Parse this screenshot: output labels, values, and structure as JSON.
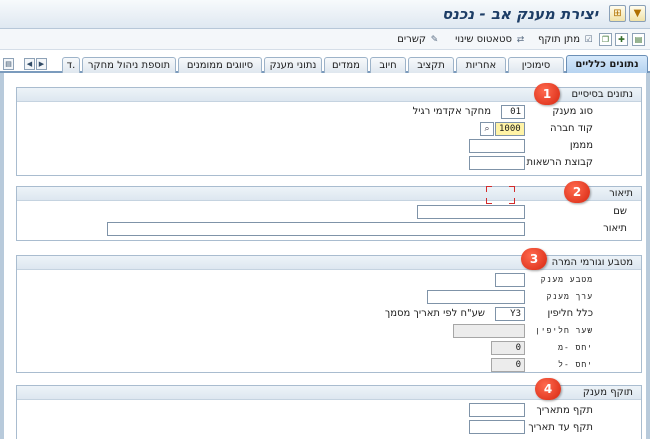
{
  "window": {
    "title": "יצירת מענק אב - נכנס"
  },
  "appbar": {
    "items": [
      {
        "label": "מתן תוקף",
        "icon": "check-list-icon"
      },
      {
        "label": "סטאטוס שינוי",
        "icon": "status-change-icon"
      },
      {
        "label": "קשרים",
        "icon": "relationships-icon"
      }
    ]
  },
  "tabs": [
    {
      "label": "נתונים כלליים",
      "active": true
    },
    {
      "label": "סימוכין"
    },
    {
      "label": "אחריות"
    },
    {
      "label": "תקציב"
    },
    {
      "label": "חיוב"
    },
    {
      "label": "ממדים"
    },
    {
      "label": "נתוני מענק"
    },
    {
      "label": "סיווגים ממומנים"
    },
    {
      "label": "תוספת ניהול מחקר"
    },
    {
      "label": "ד."
    }
  ],
  "groups": {
    "basic": {
      "badge": "1",
      "title": "נתונים בסיסיים",
      "grant_type_label": "סוג מענק",
      "grant_type_value": "01",
      "grant_type_text": "מחקר אקדמי רגיל",
      "company_code_label": "קוד חברה",
      "company_code_value": "1000",
      "sponsor_label": "מממן",
      "sponsor_value": "",
      "auth_group_label": "קבוצת הרשאות",
      "auth_group_value": ""
    },
    "description": {
      "badge": "2",
      "title": "תיאור",
      "name_label": "שם",
      "name_value": "",
      "desc_label": "תיאור",
      "desc_value": ""
    },
    "currency": {
      "badge": "3",
      "title": "מטבע וגורמי המרה",
      "grant_currency_label": "מטבע מענק",
      "grant_currency_value": "",
      "grant_value_label": "ערך מענק",
      "grant_value_value": "",
      "exchange_rule_label": "כלל חליפין",
      "exchange_rule_value": "Y3",
      "exchange_rule_text": "שע\"ח לפי תאריך מסמך",
      "exchange_rate_label": "שער חליפין",
      "exchange_rate_value": "",
      "ratio_from_label": "יחס -מ",
      "ratio_from_value": "0",
      "ratio_to_label": "יחס -ל",
      "ratio_to_value": "0"
    },
    "validity": {
      "badge": "4",
      "title": "תוקף מענק",
      "valid_from_label": "תקף מתאריך",
      "valid_from_value": "",
      "valid_to_label": "תקף עד תאריך",
      "valid_to_value": ""
    }
  },
  "colors": {
    "badge": "#d62610",
    "tab_active": "#b6d3f0",
    "title": "#1d3d66"
  }
}
